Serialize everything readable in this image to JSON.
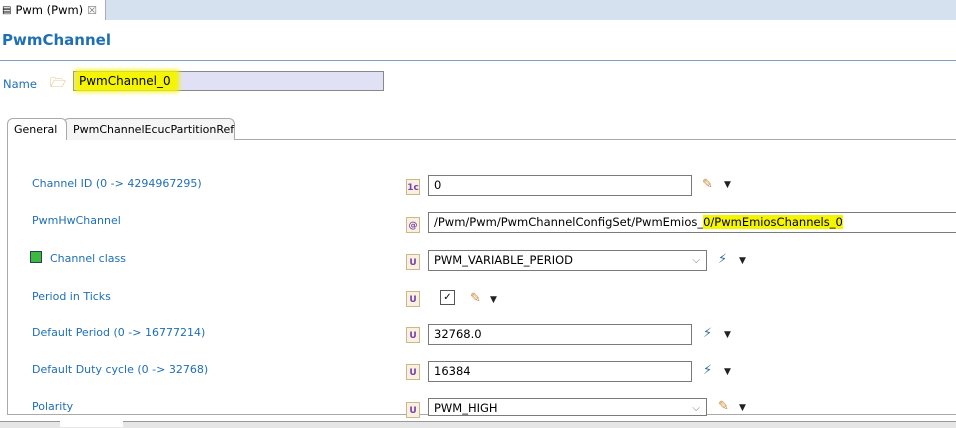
{
  "editor_tab": {
    "label": "Pwm (Pwm)",
    "close": "☒"
  },
  "page_title": "PwmChannel",
  "name_field": {
    "label": "Name",
    "value": "PwmChannel_0"
  },
  "tabs": [
    {
      "label": "General"
    },
    {
      "label": "PwmChannelEcucPartitionRef"
    }
  ],
  "fields": [
    {
      "label": "Channel ID (0 -> 4294967295)",
      "value": "0"
    },
    {
      "label": "PwmHwChannel",
      "value_plain": "/Pwm/Pwm/PwmChannelConfigSet/PwmEmios_",
      "value_hl": "0/PwmEmiosChannels_0"
    },
    {
      "label": "Channel class",
      "value": "PWM_VARIABLE_PERIOD"
    },
    {
      "label": "Period in Ticks",
      "value": "☑"
    },
    {
      "label": "Default Period (0 -> 16777214)",
      "value": "32768.0"
    },
    {
      "label": "Default Duty cycle (0 -> 32768)",
      "value": "16384"
    },
    {
      "label": "Polarity",
      "value": "PWM_HIGH"
    }
  ]
}
